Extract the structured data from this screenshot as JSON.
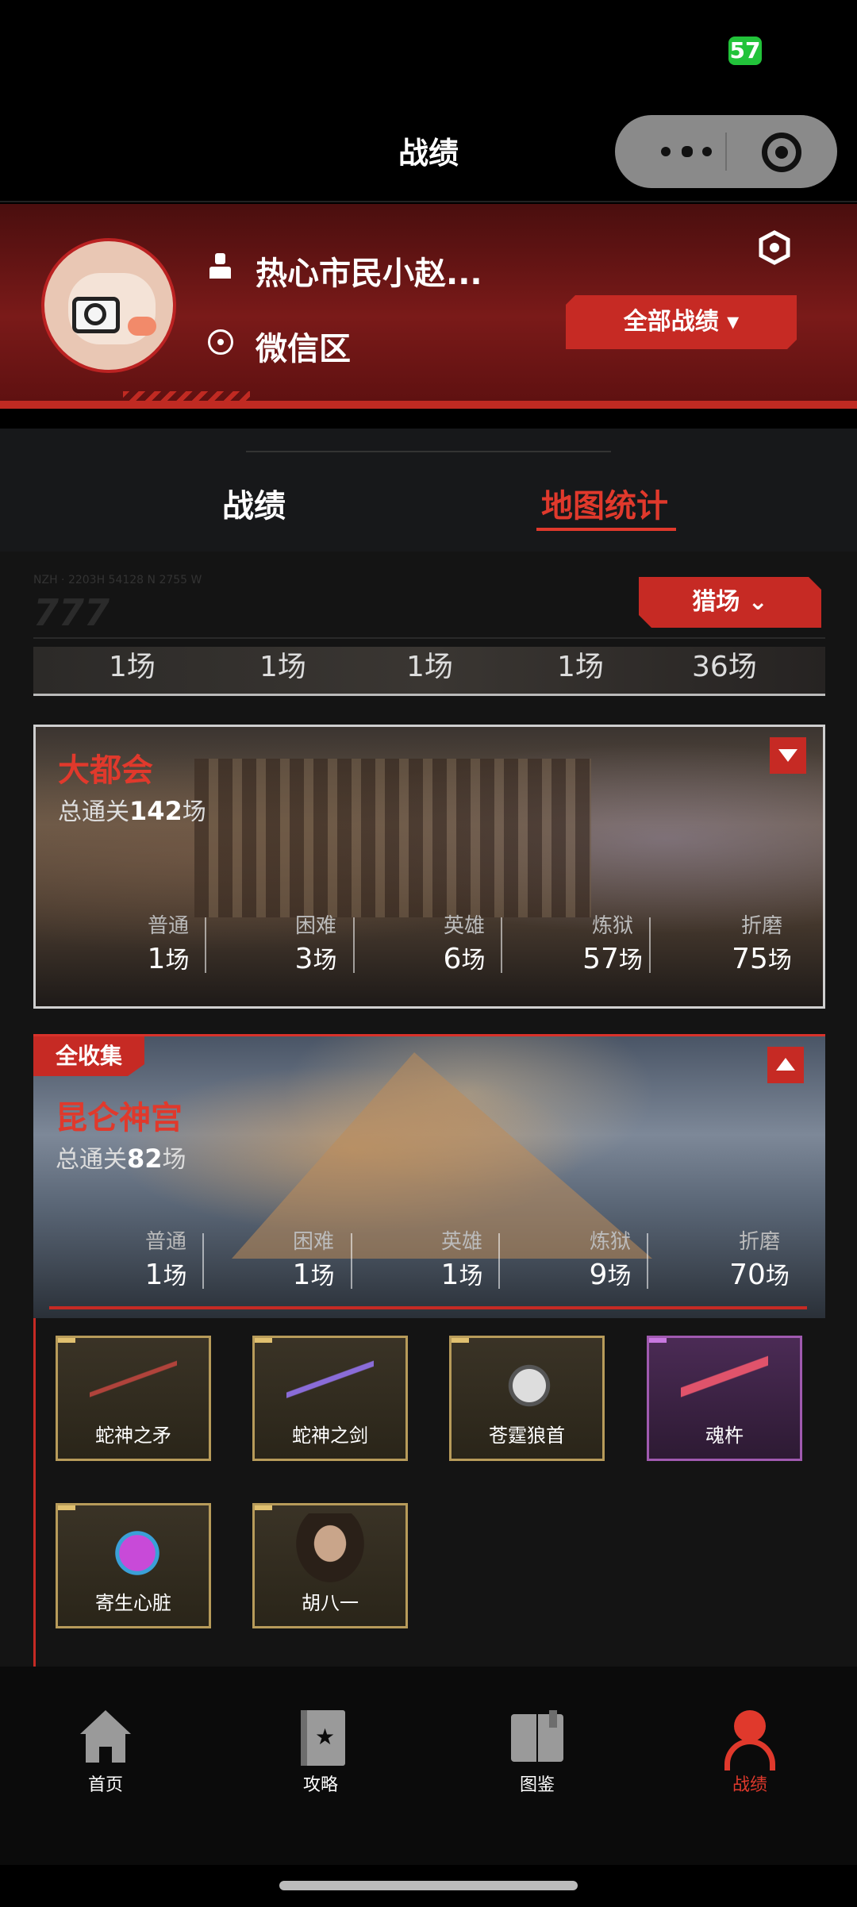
{
  "status_bar": {
    "battery": "57"
  },
  "nav": {
    "title": "战绩"
  },
  "profile": {
    "username": "热心市民小赵...",
    "region": "微信区",
    "all_records_label": "全部战绩 ▾"
  },
  "tabs": [
    {
      "label": "战绩"
    },
    {
      "label": "地图统计"
    }
  ],
  "filter": {
    "label": "猎场 ⌄"
  },
  "partial_card": {
    "values": [
      "1场",
      "1场",
      "1场",
      "1场",
      "36场"
    ]
  },
  "maps": [
    {
      "name": "大都会",
      "total_prefix": "总通关",
      "total_value": "142",
      "total_suffix": "场",
      "expanded": false,
      "stats": [
        {
          "label": "普通",
          "value": "1",
          "unit": "场"
        },
        {
          "label": "困难",
          "value": "3",
          "unit": "场"
        },
        {
          "label": "英雄",
          "value": "6",
          "unit": "场"
        },
        {
          "label": "炼狱",
          "value": "57",
          "unit": "场"
        },
        {
          "label": "折磨",
          "value": "75",
          "unit": "场"
        }
      ]
    },
    {
      "badge": "全收集",
      "name": "昆仑神宫",
      "total_prefix": "总通关",
      "total_value": "82",
      "total_suffix": "场",
      "expanded": true,
      "stats": [
        {
          "label": "普通",
          "value": "1",
          "unit": "场"
        },
        {
          "label": "困难",
          "value": "1",
          "unit": "场"
        },
        {
          "label": "英雄",
          "value": "1",
          "unit": "场"
        },
        {
          "label": "炼狱",
          "value": "9",
          "unit": "场"
        },
        {
          "label": "折磨",
          "value": "70",
          "unit": "场"
        }
      ]
    }
  ],
  "collection": [
    {
      "name": "蛇神之矛",
      "rarity": "gold",
      "icon": "spear-icon"
    },
    {
      "name": "蛇神之剑",
      "rarity": "gold",
      "icon": "sword-icon"
    },
    {
      "name": "苍霆狼首",
      "rarity": "gold",
      "icon": "wolf-head-icon"
    },
    {
      "name": "魂杵",
      "rarity": "purple",
      "icon": "pestle-icon"
    },
    {
      "name": "寄生心脏",
      "rarity": "gold",
      "icon": "heart-icon"
    },
    {
      "name": "胡八一",
      "rarity": "gold",
      "icon": "portrait-icon"
    }
  ],
  "tabbar": [
    {
      "label": "首页",
      "icon": "home-icon"
    },
    {
      "label": "攻略",
      "icon": "guide-book-icon"
    },
    {
      "label": "图鉴",
      "icon": "atlas-icon"
    },
    {
      "label": "战绩",
      "icon": "profile-icon",
      "active": true
    }
  ],
  "colors": {
    "accent": "#c62a24",
    "active_text": "#e0392c",
    "gold_border": "#b79b5a",
    "purple_border": "#a05ab0"
  }
}
